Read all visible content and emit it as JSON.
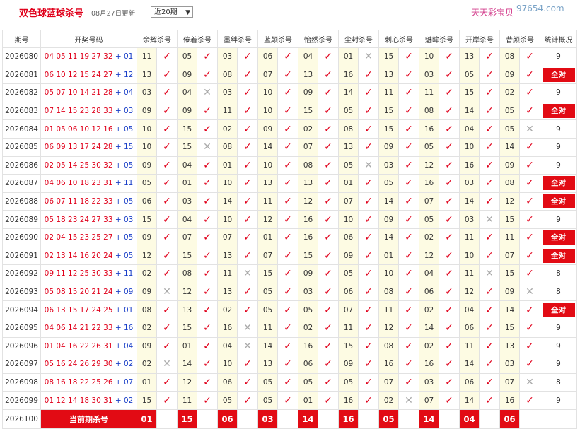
{
  "header": {
    "title": "双色球蓝球杀号",
    "updated": "08月27日更新",
    "period_select": "近20期",
    "brand": "天天彩宝贝",
    "watermark": "97654.com"
  },
  "columns": {
    "period": "期号",
    "draw": "开奖号码",
    "experts": [
      "余辉杀号",
      "傣着杀号",
      "墨绊杀号",
      "蓝颠杀号",
      "怡然杀号",
      "尘封杀号",
      "刺心杀号",
      "魅眸杀号",
      "开岸杀号",
      "昔颜杀号"
    ],
    "stat": "统计概况"
  },
  "rows": [
    {
      "period": "2026080",
      "reds": "04 05 11 19 27 32",
      "blue": "01",
      "nums": [
        "11",
        "05",
        "03",
        "06",
        "04",
        "01",
        "15",
        "10",
        "13",
        "08"
      ],
      "marks": [
        "ok",
        "ok",
        "ok",
        "ok",
        "ok",
        "bad",
        "ok",
        "ok",
        "ok",
        "ok"
      ],
      "stat": "9"
    },
    {
      "period": "2026081",
      "reds": "06 10 12 15 24 27",
      "blue": "12",
      "nums": [
        "13",
        "09",
        "08",
        "07",
        "13",
        "16",
        "13",
        "03",
        "05",
        "09"
      ],
      "marks": [
        "ok",
        "ok",
        "ok",
        "ok",
        "ok",
        "ok",
        "ok",
        "ok",
        "ok",
        "ok"
      ],
      "stat": "全对"
    },
    {
      "period": "2026082",
      "reds": "05 07 10 14 21 28",
      "blue": "04",
      "nums": [
        "03",
        "04",
        "03",
        "10",
        "09",
        "14",
        "11",
        "11",
        "15",
        "02"
      ],
      "marks": [
        "ok",
        "bad",
        "ok",
        "ok",
        "ok",
        "ok",
        "ok",
        "ok",
        "ok",
        "ok"
      ],
      "stat": "9"
    },
    {
      "period": "2026083",
      "reds": "07 14 15 23 28 33",
      "blue": "03",
      "nums": [
        "09",
        "09",
        "11",
        "10",
        "15",
        "05",
        "15",
        "08",
        "14",
        "05"
      ],
      "marks": [
        "ok",
        "ok",
        "ok",
        "ok",
        "ok",
        "ok",
        "ok",
        "ok",
        "ok",
        "ok"
      ],
      "stat": "全对"
    },
    {
      "period": "2026084",
      "reds": "01 05 06 10 12 16",
      "blue": "05",
      "nums": [
        "10",
        "15",
        "02",
        "09",
        "02",
        "08",
        "15",
        "16",
        "04",
        "05"
      ],
      "marks": [
        "ok",
        "ok",
        "ok",
        "ok",
        "ok",
        "ok",
        "ok",
        "ok",
        "ok",
        "bad"
      ],
      "stat": "9"
    },
    {
      "period": "2026085",
      "reds": "06 09 13 17 24 28",
      "blue": "15",
      "nums": [
        "10",
        "15",
        "08",
        "14",
        "07",
        "13",
        "09",
        "05",
        "10",
        "14"
      ],
      "marks": [
        "ok",
        "bad",
        "ok",
        "ok",
        "ok",
        "ok",
        "ok",
        "ok",
        "ok",
        "ok"
      ],
      "stat": "9"
    },
    {
      "period": "2026086",
      "reds": "02 05 14 25 30 32",
      "blue": "05",
      "nums": [
        "09",
        "04",
        "01",
        "10",
        "08",
        "05",
        "03",
        "12",
        "16",
        "09"
      ],
      "marks": [
        "ok",
        "ok",
        "ok",
        "ok",
        "ok",
        "bad",
        "ok",
        "ok",
        "ok",
        "ok"
      ],
      "stat": "9"
    },
    {
      "period": "2026087",
      "reds": "04 06 10 18 23 31",
      "blue": "11",
      "nums": [
        "05",
        "01",
        "10",
        "13",
        "13",
        "01",
        "05",
        "16",
        "03",
        "08"
      ],
      "marks": [
        "ok",
        "ok",
        "ok",
        "ok",
        "ok",
        "ok",
        "ok",
        "ok",
        "ok",
        "ok"
      ],
      "stat": "全对"
    },
    {
      "period": "2026088",
      "reds": "06 07 11 18 22 33",
      "blue": "05",
      "nums": [
        "06",
        "03",
        "14",
        "11",
        "12",
        "07",
        "14",
        "07",
        "14",
        "12"
      ],
      "marks": [
        "ok",
        "ok",
        "ok",
        "ok",
        "ok",
        "ok",
        "ok",
        "ok",
        "ok",
        "ok"
      ],
      "stat": "全对"
    },
    {
      "period": "2026089",
      "reds": "05 18 23 24 27 33",
      "blue": "03",
      "nums": [
        "15",
        "04",
        "10",
        "12",
        "16",
        "10",
        "09",
        "05",
        "03",
        "15"
      ],
      "marks": [
        "ok",
        "ok",
        "ok",
        "ok",
        "ok",
        "ok",
        "ok",
        "ok",
        "bad",
        "ok"
      ],
      "stat": "9"
    },
    {
      "period": "2026090",
      "reds": "02 04 15 23 25 27",
      "blue": "05",
      "nums": [
        "09",
        "07",
        "07",
        "01",
        "16",
        "06",
        "14",
        "02",
        "11",
        "11"
      ],
      "marks": [
        "ok",
        "ok",
        "ok",
        "ok",
        "ok",
        "ok",
        "ok",
        "ok",
        "ok",
        "ok"
      ],
      "stat": "全对"
    },
    {
      "period": "2026091",
      "reds": "02 13 14 16 20 24",
      "blue": "05",
      "nums": [
        "12",
        "15",
        "13",
        "07",
        "15",
        "09",
        "01",
        "12",
        "10",
        "07"
      ],
      "marks": [
        "ok",
        "ok",
        "ok",
        "ok",
        "ok",
        "ok",
        "ok",
        "ok",
        "ok",
        "ok"
      ],
      "stat": "全对"
    },
    {
      "period": "2026092",
      "reds": "09 11 12 25 30 33",
      "blue": "11",
      "nums": [
        "02",
        "08",
        "11",
        "15",
        "09",
        "05",
        "10",
        "04",
        "11",
        "15"
      ],
      "marks": [
        "ok",
        "ok",
        "bad",
        "ok",
        "ok",
        "ok",
        "ok",
        "ok",
        "bad",
        "ok"
      ],
      "stat": "8"
    },
    {
      "period": "2026093",
      "reds": "05 08 15 20 21 24",
      "blue": "09",
      "nums": [
        "09",
        "12",
        "13",
        "05",
        "03",
        "06",
        "08",
        "06",
        "12",
        "09"
      ],
      "marks": [
        "bad",
        "ok",
        "ok",
        "ok",
        "ok",
        "ok",
        "ok",
        "ok",
        "ok",
        "bad"
      ],
      "stat": "8"
    },
    {
      "period": "2026094",
      "reds": "06 13 15 17 24 25",
      "blue": "01",
      "nums": [
        "08",
        "13",
        "02",
        "05",
        "05",
        "07",
        "11",
        "02",
        "04",
        "14"
      ],
      "marks": [
        "ok",
        "ok",
        "ok",
        "ok",
        "ok",
        "ok",
        "ok",
        "ok",
        "ok",
        "ok"
      ],
      "stat": "全对"
    },
    {
      "period": "2026095",
      "reds": "04 06 14 21 22 33",
      "blue": "16",
      "nums": [
        "02",
        "15",
        "16",
        "11",
        "02",
        "11",
        "12",
        "14",
        "06",
        "15"
      ],
      "marks": [
        "ok",
        "ok",
        "bad",
        "ok",
        "ok",
        "ok",
        "ok",
        "ok",
        "ok",
        "ok"
      ],
      "stat": "9"
    },
    {
      "period": "2026096",
      "reds": "01 04 16 22 26 31",
      "blue": "04",
      "nums": [
        "09",
        "01",
        "04",
        "14",
        "16",
        "15",
        "08",
        "02",
        "11",
        "13"
      ],
      "marks": [
        "ok",
        "ok",
        "bad",
        "ok",
        "ok",
        "ok",
        "ok",
        "ok",
        "ok",
        "ok"
      ],
      "stat": "9"
    },
    {
      "period": "2026097",
      "reds": "05 16 24 26 29 30",
      "blue": "02",
      "nums": [
        "02",
        "14",
        "10",
        "13",
        "06",
        "09",
        "16",
        "16",
        "14",
        "03"
      ],
      "marks": [
        "bad",
        "ok",
        "ok",
        "ok",
        "ok",
        "ok",
        "ok",
        "ok",
        "ok",
        "ok"
      ],
      "stat": "9"
    },
    {
      "period": "2026098",
      "reds": "08 16 18 22 25 26",
      "blue": "07",
      "nums": [
        "01",
        "12",
        "06",
        "05",
        "05",
        "05",
        "07",
        "03",
        "06",
        "07"
      ],
      "marks": [
        "ok",
        "ok",
        "ok",
        "ok",
        "ok",
        "ok",
        "ok",
        "ok",
        "ok",
        "bad"
      ],
      "stat": "8"
    },
    {
      "period": "2026099",
      "reds": "01 12 14 18 30 31",
      "blue": "02",
      "nums": [
        "15",
        "11",
        "05",
        "05",
        "01",
        "16",
        "02",
        "07",
        "14",
        "16"
      ],
      "marks": [
        "ok",
        "ok",
        "ok",
        "ok",
        "ok",
        "ok",
        "bad",
        "ok",
        "ok",
        "ok"
      ],
      "stat": "9"
    }
  ],
  "current": {
    "period": "2026100",
    "label": "当前期杀号",
    "nums": [
      "01",
      "15",
      "06",
      "03",
      "14",
      "16",
      "05",
      "14",
      "04",
      "06"
    ]
  },
  "glyphs": {
    "ok": "✓",
    "bad": "✕"
  },
  "colors": {
    "red": "#e0001b",
    "blue": "#1b40c8",
    "highlight": "#e20b14",
    "cell_bg": "#fdfbe3"
  }
}
